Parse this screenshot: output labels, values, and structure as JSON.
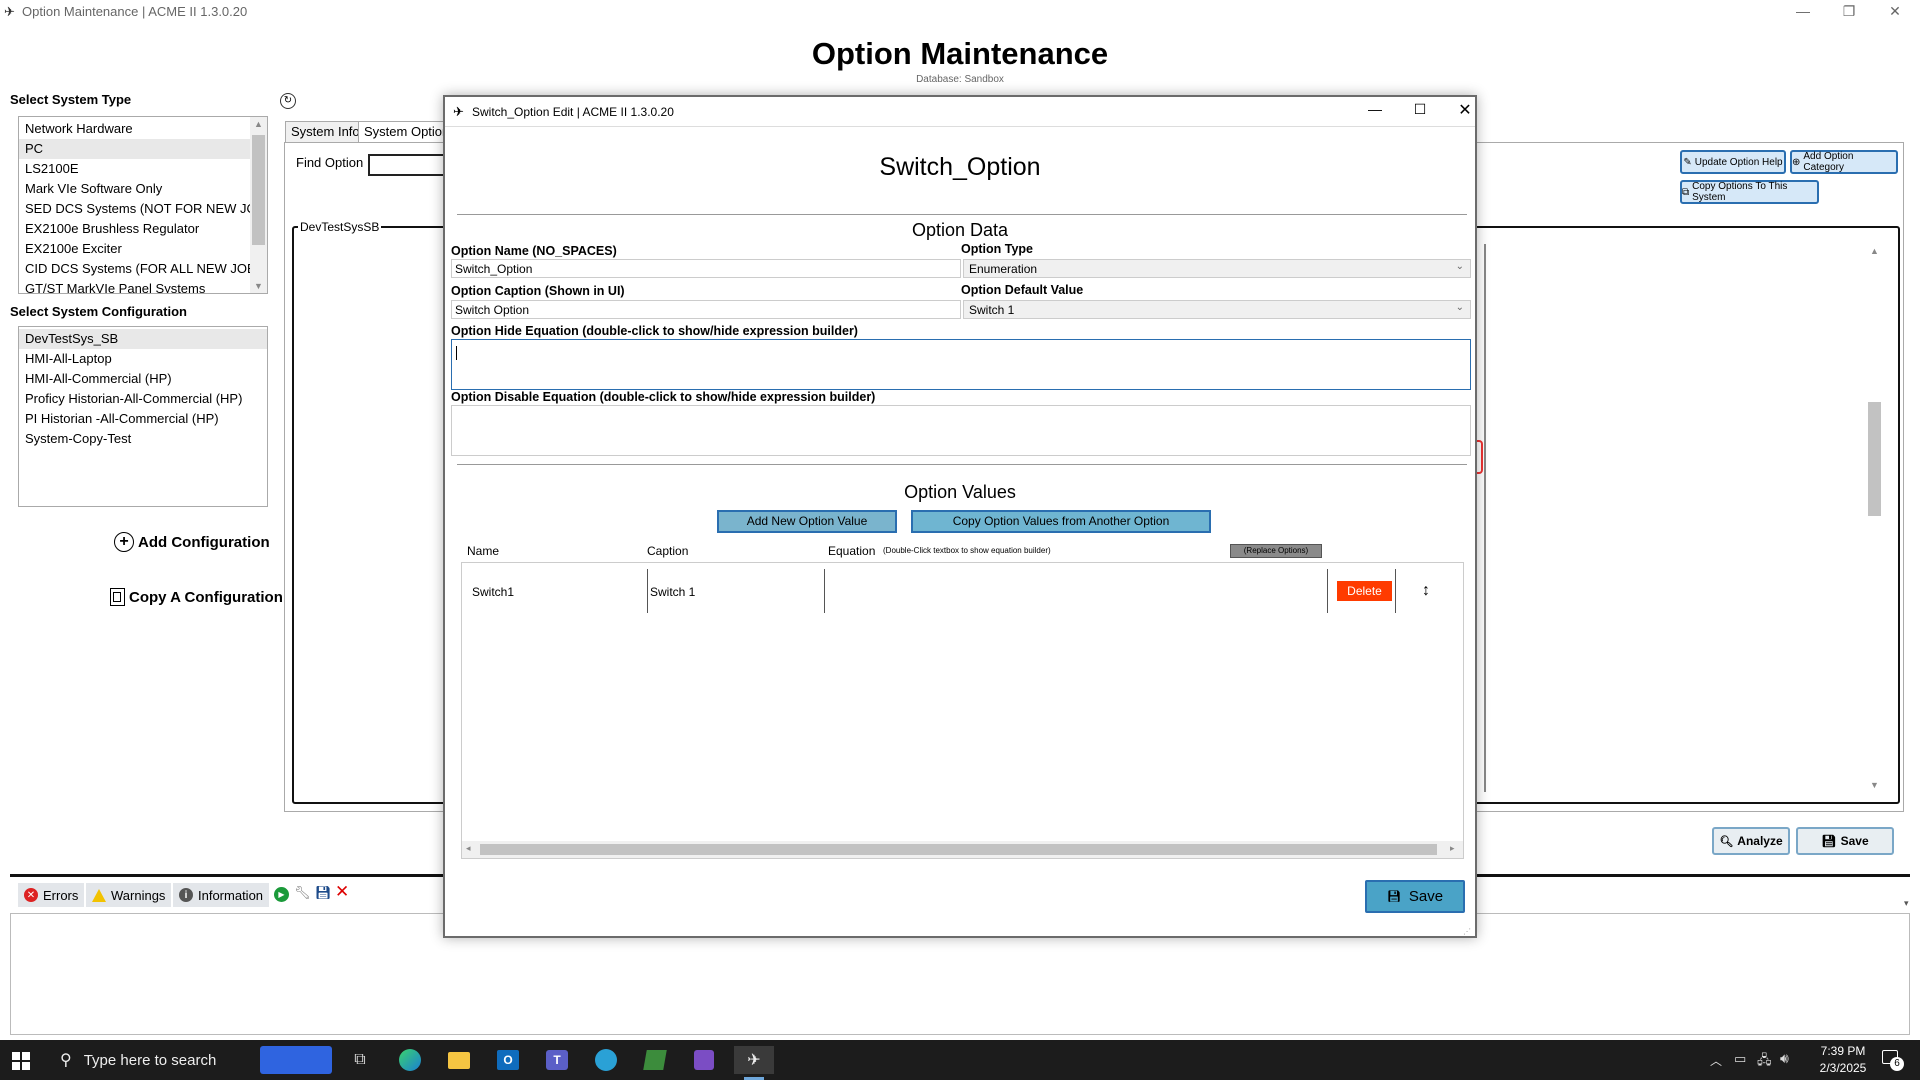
{
  "main_window": {
    "title": "Option Maintenance | ACME II 1.3.0.20",
    "page_title": "Option Maintenance",
    "database_label": "Database: Sandbox"
  },
  "left_panel": {
    "system_type_label": "Select System Type",
    "system_types": [
      "Network Hardware",
      "PC",
      "LS2100E",
      "Mark VIe Software Only",
      "SED DCS Systems (NOT FOR NEW JOBS)",
      "EX2100e Brushless Regulator",
      "EX2100e Exciter",
      "CID DCS Systems (FOR ALL NEW JOBS)",
      "GT/ST MarkVIe Panel Systems"
    ],
    "system_config_label": "Select System Configuration",
    "system_configs": [
      "DevTestSys_SB",
      "HMI-All-Laptop",
      "HMI-All-Commercial (HP)",
      "Proficy Historian-All-Commercial (HP)",
      "PI Historian -All-Commercial (HP)",
      "System-Copy-Test"
    ],
    "add_configuration": "Add Configuration",
    "copy_configuration": "Copy A Configuration"
  },
  "main_area": {
    "tabs": [
      "System Info",
      "System Options"
    ],
    "find_option_label": "Find Option",
    "group_label": "DevTestSysSB",
    "update_option_help": "Update Option Help",
    "add_option_category": "Add Option Category",
    "copy_options": "Copy Options To This System",
    "analyze": "Analyze",
    "save": "Save"
  },
  "log_panel": {
    "errors": "Errors",
    "warnings": "Warnings",
    "information": "Information"
  },
  "dialog": {
    "title": "Switch_Option Edit | ACME II 1.3.0.20",
    "heading": "Switch_Option",
    "option_data_heading": "Option Data",
    "option_name_label": "Option Name (NO_SPACES)",
    "option_name_value": "Switch_Option",
    "option_type_label": "Option Type",
    "option_type_value": "Enumeration",
    "option_caption_label": "Option Caption (Shown in UI)",
    "option_caption_value": "Switch Option",
    "option_default_label": "Option Default Value",
    "option_default_value": "Switch 1",
    "hide_equation_label": "Option Hide Equation (double-click to show/hide expression builder)",
    "disable_equation_label": "Option Disable Equation (double-click to show/hide expression builder)",
    "option_values_heading": "Option Values",
    "add_new_value": "Add New Option Value",
    "copy_values": "Copy Option Values from Another Option",
    "col_name": "Name",
    "col_caption": "Caption",
    "col_equation": "Equation",
    "col_equation_hint": "(Double-Click textbox to show equation builder)",
    "replace_options": "(Replace Options)",
    "rows": [
      {
        "name": "Switch1",
        "caption": "Switch 1",
        "equation": "",
        "delete": "Delete"
      }
    ],
    "save": "Save"
  },
  "taskbar": {
    "search_placeholder": "Type here to search",
    "time": "7:39 PM",
    "date": "2/3/2025",
    "notification_count": "6"
  },
  "colors": {
    "delete_button": "#ff3b00",
    "dialog_primary_button": "#4aa3c7",
    "option_button": "#6fb5d1"
  }
}
